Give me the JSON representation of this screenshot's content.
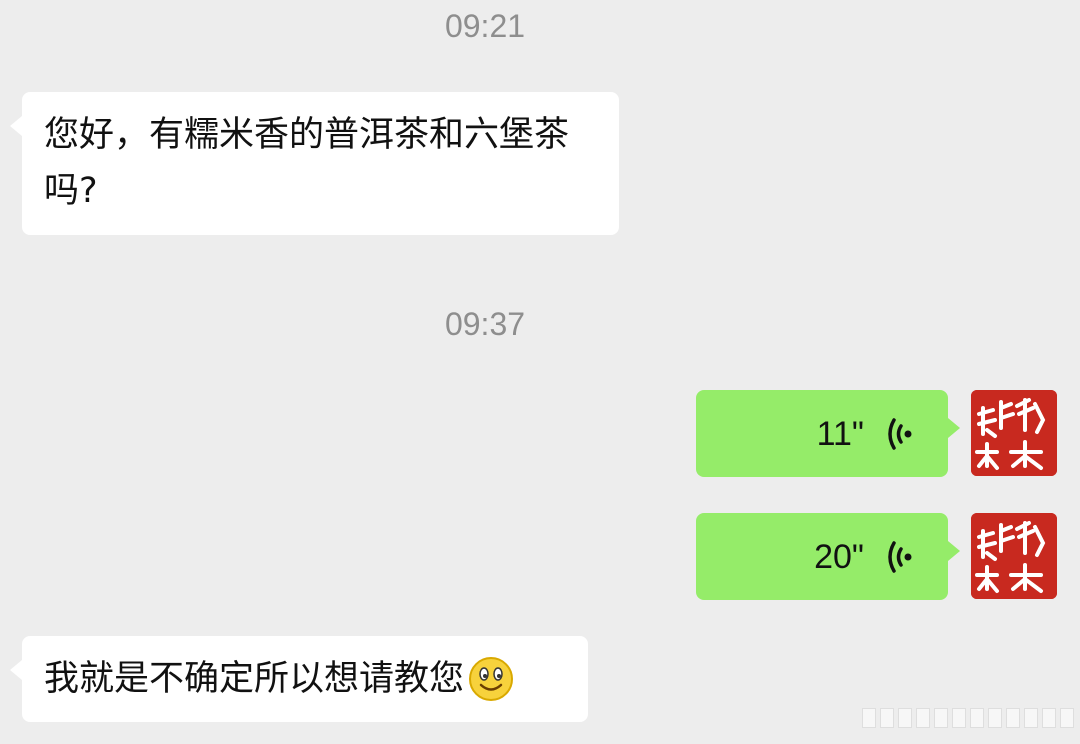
{
  "messages": {
    "time1": "09:21",
    "msg1_text": "您好，有糯米香的普洱茶和六堡茶吗?",
    "time2": "09:37",
    "voice1_duration": "11\"",
    "voice2_duration": "20\"",
    "msg2_text": "我就是不确定所以想请教您"
  },
  "icons": {
    "voice": "voice-wave-icon",
    "avatar": "seal-avatar",
    "emoji": "smile-emoji-icon"
  },
  "colors": {
    "background": "#ededed",
    "incoming_bubble": "#ffffff",
    "outgoing_bubble": "#95ec69",
    "timestamp": "#8e8e8e",
    "avatar_red": "#c8291f"
  }
}
